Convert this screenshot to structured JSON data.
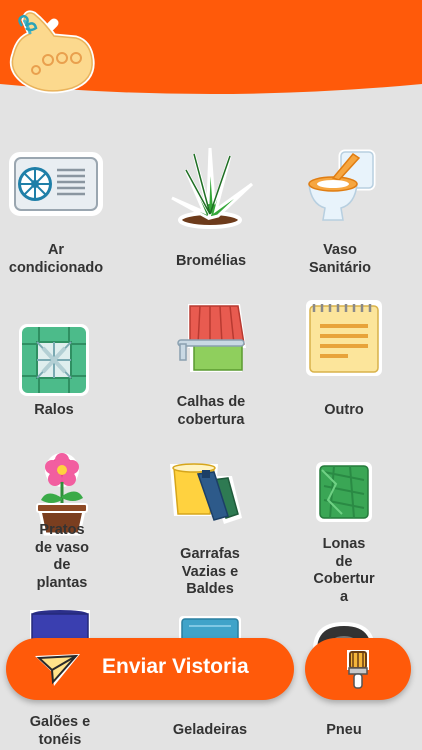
{
  "header": {
    "back_icon": "chevron-left-icon",
    "logo_icon": "hand-icon"
  },
  "items": [
    {
      "label": "Ar\ncondicionado",
      "icon": "air-conditioner-icon"
    },
    {
      "label": "Bromélias",
      "icon": "bromeliad-plant-icon"
    },
    {
      "label": "Vaso\nSanitário",
      "icon": "toilet-icon"
    },
    {
      "label": "Ralos",
      "icon": "drain-icon"
    },
    {
      "label": "Calhas de\ncobertura",
      "icon": "roof-gutter-icon"
    },
    {
      "label": "Outro",
      "icon": "note-icon"
    },
    {
      "label": "Pratos\nde vaso\nde\nplantas",
      "icon": "flower-pot-icon"
    },
    {
      "label": "Garrafas\nVazias e\nBaldes",
      "icon": "bottles-bucket-icon"
    },
    {
      "label": "Lonas\nde\nCobertur\na",
      "icon": "tarp-icon"
    },
    {
      "label": "Galões e\ntonéis",
      "icon": "barrel-icon"
    },
    {
      "label": "Geladeiras",
      "icon": "fridge-icon"
    },
    {
      "label": "Pneu",
      "icon": "tire-icon"
    }
  ],
  "actions": {
    "send_label": "Enviar Vistoria",
    "send_icon": "paper-plane-icon",
    "brush_icon": "brush-icon"
  },
  "colors": {
    "accent": "#ff5a0a",
    "background": "#e3e3e3"
  }
}
